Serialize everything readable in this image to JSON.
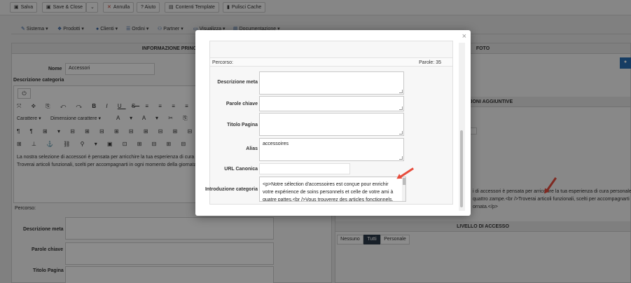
{
  "toolbar": {
    "save": "Salva",
    "save_close": "Save & Close",
    "cancel": "Annulla",
    "help": "? Aiuto",
    "template": "Contenti Template",
    "cache": "Pulisci Cache"
  },
  "menu": {
    "items": [
      "Sistema",
      "Prodotti",
      "Clienti",
      "Ordini",
      "Partner",
      "Visualizza",
      "Documentazione"
    ]
  },
  "left_panel": {
    "header": "INFORMAZIONE PRINCIP",
    "name_label": "Nome",
    "name_value": "Accessori",
    "desc_label": "Descrizione categoria",
    "font_label": "Carattere",
    "size_label": "Dimensione carattere",
    "text_lines": [
      "La nostra selezione di accessori è pensata per arricchire la tua esperienza di cura",
      "Troverai articoli funzionali, scelti per accompagnarti in ogni momento della giornata"
    ],
    "path_label": "Percorso:",
    "meta_label": "Descrizione meta",
    "keywords_label": "Parole chiave",
    "title_label": "Titolo Pagina"
  },
  "right_panel": {
    "photo_header": "FOTO",
    "info_header": "ORMAZIONI AGGIUNTIVE",
    "text_lines": [
      "i di accessori è pensata per arricchire la tua esperienza di cura personale e",
      "quattro zampe.<br />Troverai articoli funzionali, scelti per accompagnarti in",
      "ornata.</p>"
    ],
    "access_header": "LIVELLO DI ACCESSO",
    "access_tabs": [
      "Nessuno",
      "Tutti",
      "Personale"
    ],
    "access_active": "Tutti"
  },
  "modal": {
    "close": "×",
    "path_label": "Percorso:",
    "word_count": "Parole: 35",
    "rows": {
      "meta_label": "Descrizione meta",
      "keywords_label": "Parole chiave",
      "title_label": "Titolo Pagina",
      "alias_label": "Alias",
      "alias_value": "accessoires",
      "url_label": "URL Canonica",
      "intro_label": "Introduzione categoria",
      "intro_lines": [
        "<p>Notre sélection d'accessoires est conçue pour enrichir",
        "votre expérience de soins personnels et celle de votre ami à",
        "quatre pattes.<br />Vous trouverez des articles fonctionnels,"
      ]
    }
  },
  "colors": {
    "accent": "#2a5a9c",
    "arrow": "#e74c3c",
    "dark_tab": "#2b3a4a"
  }
}
